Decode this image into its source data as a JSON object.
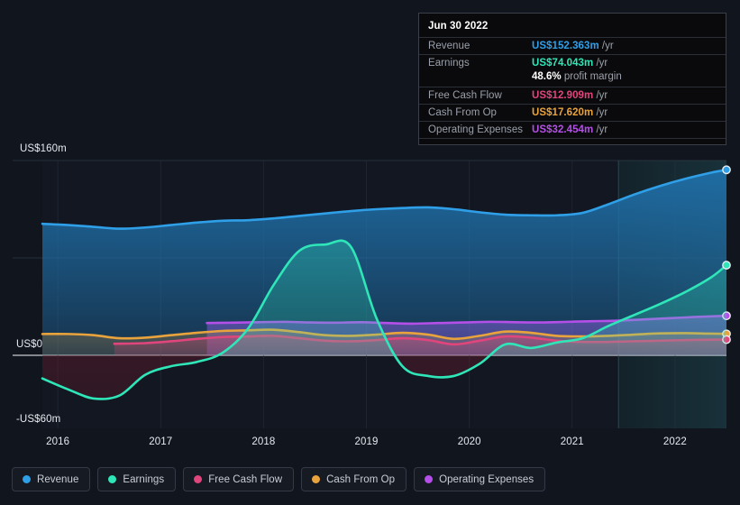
{
  "tooltip": {
    "date": "Jun 30 2022",
    "rows": [
      {
        "label": "Revenue",
        "value": "US$152.363m",
        "unit": "/yr",
        "color": "#2f9fe8"
      },
      {
        "label": "Earnings",
        "value": "US$74.043m",
        "unit": "/yr",
        "color": "#2ee6b8"
      },
      {
        "label": "",
        "value": "48.6%",
        "unit": "profit margin",
        "color": "#ffffff",
        "is_margin": true
      },
      {
        "label": "Free Cash Flow",
        "value": "US$12.909m",
        "unit": "/yr",
        "color": "#e0457b"
      },
      {
        "label": "Cash From Op",
        "value": "US$17.620m",
        "unit": "/yr",
        "color": "#e8a33d"
      },
      {
        "label": "Operating Expenses",
        "value": "US$32.454m",
        "unit": "/yr",
        "color": "#b44fe8"
      }
    ]
  },
  "legend": {
    "items": [
      {
        "label": "Revenue",
        "color": "#2f9fe8"
      },
      {
        "label": "Earnings",
        "color": "#2ee6b8"
      },
      {
        "label": "Free Cash Flow",
        "color": "#e0457b"
      },
      {
        "label": "Cash From Op",
        "color": "#e8a33d"
      },
      {
        "label": "Operating Expenses",
        "color": "#b44fe8"
      }
    ]
  },
  "axis": {
    "y_top": "US$160m",
    "y_zero": "US$0",
    "y_bottom": "-US$60m",
    "x_ticks": [
      "2016",
      "2017",
      "2018",
      "2019",
      "2020",
      "2021",
      "2022"
    ]
  },
  "chart_data": {
    "type": "area",
    "title": "",
    "xlabel": "",
    "ylabel": "",
    "ylim": [
      -60,
      160
    ],
    "xlim": [
      2015.85,
      2022.5
    ],
    "grid": true,
    "legend_position": "bottom",
    "gridlines_y": [
      160,
      80,
      0
    ],
    "x_tick_values": [
      2016,
      2017,
      2018,
      2019,
      2020,
      2021,
      2022
    ],
    "forecast_start": 2021.45,
    "series": [
      {
        "name": "Revenue",
        "color": "#2f9fe8",
        "x": [
          2015.85,
          2016.1,
          2016.35,
          2016.6,
          2016.85,
          2017.1,
          2017.35,
          2017.6,
          2017.85,
          2018.1,
          2018.35,
          2018.6,
          2018.85,
          2019.1,
          2019.35,
          2019.6,
          2019.85,
          2020.1,
          2020.35,
          2020.6,
          2020.85,
          2021.1,
          2021.35,
          2021.6,
          2021.85,
          2022.1,
          2022.35,
          2022.5
        ],
        "values": [
          108.0,
          107.0,
          105.5,
          104.0,
          105.0,
          107.0,
          109.0,
          110.5,
          111.0,
          112.5,
          114.5,
          116.5,
          118.5,
          120.0,
          121.0,
          121.5,
          120.0,
          117.5,
          115.5,
          115.0,
          115.0,
          117.0,
          124.0,
          132.0,
          139.0,
          145.0,
          150.0,
          152.363
        ]
      },
      {
        "name": "Earnings",
        "color": "#2ee6b8",
        "x": [
          2015.85,
          2016.1,
          2016.35,
          2016.6,
          2016.85,
          2017.1,
          2017.35,
          2017.6,
          2017.85,
          2018.1,
          2018.35,
          2018.6,
          2018.85,
          2019.1,
          2019.35,
          2019.6,
          2019.85,
          2020.1,
          2020.35,
          2020.6,
          2020.85,
          2021.1,
          2021.35,
          2021.6,
          2021.85,
          2022.1,
          2022.35,
          2022.5
        ],
        "values": [
          -19.0,
          -28.0,
          -35.5,
          -33.0,
          -16.0,
          -9.0,
          -5.5,
          2.0,
          22.0,
          58.0,
          86.0,
          91.0,
          89.0,
          30.0,
          -9.0,
          -17.0,
          -17.0,
          -7.0,
          9.0,
          6.0,
          10.5,
          14.0,
          24.0,
          33.0,
          42.0,
          52.0,
          64.0,
          74.043
        ]
      },
      {
        "name": "Free Cash Flow",
        "color": "#e0457b",
        "x": [
          2016.55,
          2016.85,
          2017.1,
          2017.35,
          2017.6,
          2017.85,
          2018.1,
          2018.35,
          2018.6,
          2018.85,
          2019.1,
          2019.35,
          2019.6,
          2019.85,
          2020.1,
          2020.35,
          2020.6,
          2020.85,
          2021.1,
          2021.35,
          2021.6,
          2021.85,
          2022.1,
          2022.35,
          2022.5
        ],
        "values": [
          9.5,
          10.0,
          11.5,
          13.5,
          15.0,
          15.5,
          16.0,
          14.0,
          12.0,
          11.5,
          12.5,
          14.0,
          12.5,
          9.0,
          12.0,
          15.5,
          14.5,
          12.0,
          11.0,
          11.0,
          11.5,
          12.0,
          12.5,
          12.8,
          12.909
        ]
      },
      {
        "name": "Cash From Op",
        "color": "#e8a33d",
        "x": [
          2015.85,
          2016.1,
          2016.35,
          2016.6,
          2016.85,
          2017.1,
          2017.35,
          2017.6,
          2017.85,
          2018.1,
          2018.35,
          2018.6,
          2018.85,
          2019.1,
          2019.35,
          2019.6,
          2019.85,
          2020.1,
          2020.35,
          2020.6,
          2020.85,
          2021.1,
          2021.35,
          2021.6,
          2021.85,
          2022.1,
          2022.35,
          2022.5
        ],
        "values": [
          17.5,
          17.5,
          16.5,
          14.0,
          14.5,
          16.5,
          18.5,
          20.0,
          20.5,
          21.0,
          19.0,
          16.5,
          16.0,
          17.0,
          18.5,
          17.0,
          13.5,
          16.0,
          19.5,
          18.5,
          16.0,
          15.5,
          16.0,
          17.0,
          18.0,
          18.2,
          17.8,
          17.62
        ]
      },
      {
        "name": "Operating Expenses",
        "color": "#b44fe8",
        "x": [
          2017.45,
          2017.7,
          2017.95,
          2018.2,
          2018.45,
          2018.7,
          2018.95,
          2019.2,
          2019.45,
          2019.7,
          2019.95,
          2020.2,
          2020.45,
          2020.7,
          2020.95,
          2021.2,
          2021.45,
          2021.7,
          2021.95,
          2022.2,
          2022.5
        ],
        "values": [
          26.5,
          26.8,
          27.2,
          27.5,
          27.0,
          26.8,
          27.2,
          26.5,
          26.0,
          26.5,
          27.0,
          27.5,
          27.2,
          27.0,
          27.5,
          28.0,
          28.5,
          29.5,
          30.5,
          31.5,
          32.454
        ]
      }
    ]
  }
}
